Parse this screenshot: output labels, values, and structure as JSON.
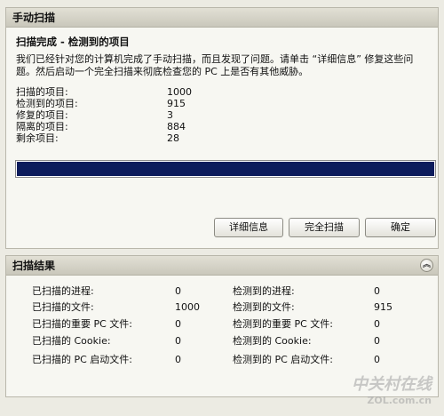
{
  "scan_panel": {
    "title": "手动扫描",
    "subtitle": "扫描完成 - 检测到的项目",
    "description": "我们已经针对您的计算机完成了手动扫描，而且发现了问题。请单击 “详细信息” 修复这些问题。然后启动一个完全扫描来彻底检查您的 PC 上是否有其他威胁。",
    "stats": [
      {
        "label": "扫描的项目:",
        "value": "1000"
      },
      {
        "label": "检测到的项目:",
        "value": "915"
      },
      {
        "label": "修复的项目:",
        "value": "3"
      },
      {
        "label": "隔离的项目:",
        "value": "884"
      },
      {
        "label": "剩余项目:",
        "value": "28"
      }
    ],
    "progress": 1.0,
    "buttons": {
      "details": "详细信息",
      "full_scan": "完全扫描",
      "ok": "确定"
    }
  },
  "results_panel": {
    "title": "扫描结果",
    "collapse_icon": "double-chevron-up-icon",
    "rows": [
      {
        "label1": "已扫描的进程:",
        "value1": "0",
        "label2": "检测到的进程:",
        "value2": "0"
      },
      {
        "label1": "已扫描的文件:",
        "value1": "1000",
        "label2": "检测到的文件:",
        "value2": "915"
      },
      {
        "label1": "已扫描的重要 PC 文件:",
        "value1": "0",
        "label2": "检测到的重要 PC 文件:",
        "value2": "0"
      },
      {
        "label1": "已扫描的 Cookie:",
        "value1": "0",
        "label2": "检测到的 Cookie:",
        "value2": "0"
      },
      {
        "label1": "已扫描的 PC 启动文件:",
        "value1": "0",
        "label2": "检测到的 PC 启动文件:",
        "value2": "0"
      }
    ]
  },
  "watermark": {
    "text": "中关村在线",
    "site": "ZOL.com.cn"
  },
  "colors": {
    "progress_fill": "#0d1c5c",
    "panel_background": "#f7f7f2",
    "page_background": "#ecebe3"
  }
}
